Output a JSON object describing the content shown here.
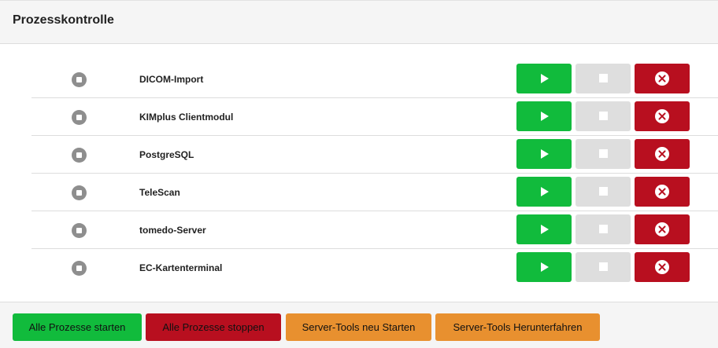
{
  "header": {
    "title": "Prozesskontrolle"
  },
  "processes": [
    {
      "name": "DICOM-Import"
    },
    {
      "name": "KIMplus Clientmodul"
    },
    {
      "name": "PostgreSQL"
    },
    {
      "name": "TeleScan"
    },
    {
      "name": "tomedo-Server"
    },
    {
      "name": "EC-Kartenterminal"
    }
  ],
  "icons": {
    "status": "stopped-status-icon",
    "start": "play-icon",
    "stop": "stop-square-icon",
    "kill": "close-circle-icon"
  },
  "colors": {
    "start": "#11bb3c",
    "stop": "#dedede",
    "kill": "#b80f1f",
    "warning": "#e8902f",
    "status_stopped": "#8e8e8e"
  },
  "footer": {
    "start_all": "Alle Prozesse starten",
    "stop_all": "Alle Prozesse stoppen",
    "restart_tools": "Server-Tools neu Starten",
    "shutdown_tools": "Server-Tools Herunterfahren"
  }
}
